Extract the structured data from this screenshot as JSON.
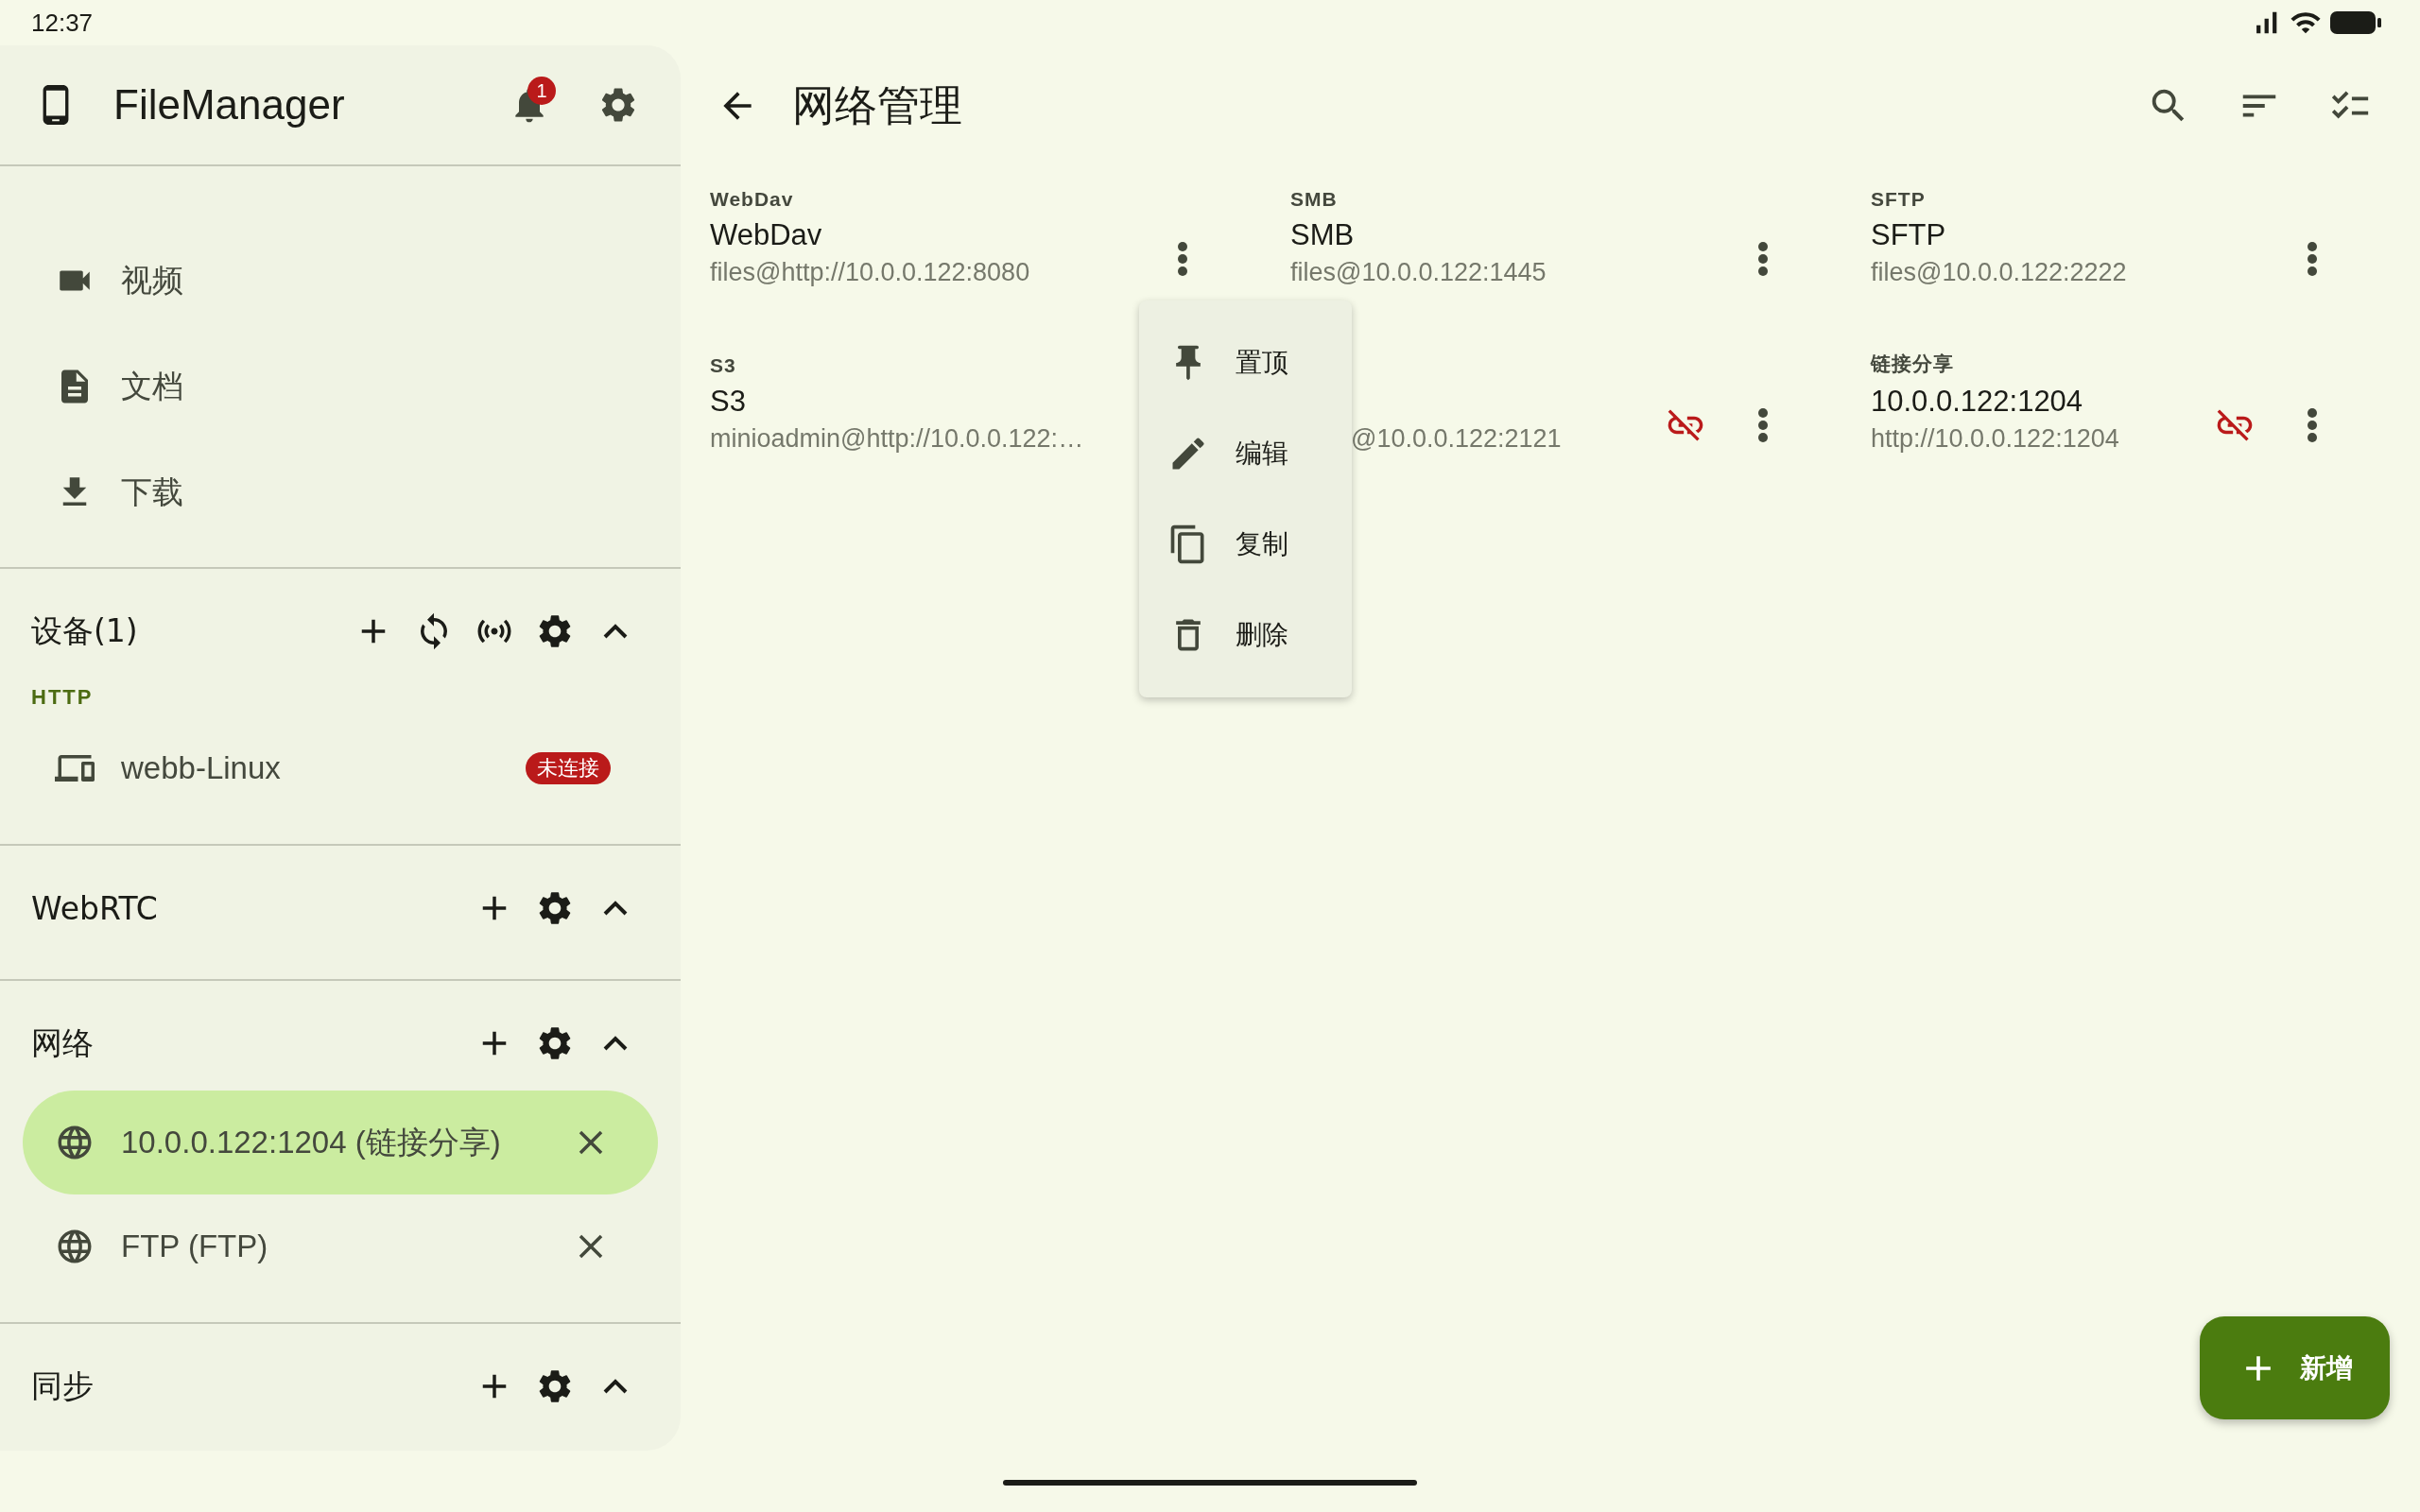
{
  "status_bar": {
    "time": "12:37"
  },
  "sidebar": {
    "title": "FileManager",
    "notification_count": "1",
    "nav_items": [
      {
        "kind": "video",
        "label": "视频"
      },
      {
        "kind": "document",
        "label": "文档"
      },
      {
        "kind": "download",
        "label": "下载"
      }
    ],
    "sections": [
      {
        "title": "设备(1)",
        "actions": [
          {
            "kind": "add"
          },
          {
            "kind": "sync"
          },
          {
            "kind": "broadcast"
          },
          {
            "kind": "settings"
          }
        ],
        "expanded": true,
        "groups": [
          {
            "subheader": "HTTP",
            "items": [
              {
                "kind": "device",
                "label": "webb-Linux",
                "badge": "未连接"
              }
            ]
          }
        ]
      },
      {
        "title": "WebRTC",
        "actions": [
          {
            "kind": "add"
          },
          {
            "kind": "settings"
          }
        ],
        "expanded": true
      },
      {
        "title": "网络",
        "actions": [
          {
            "kind": "add"
          },
          {
            "kind": "settings"
          }
        ],
        "expanded": true,
        "groups": [
          {
            "items": [
              {
                "kind": "network",
                "label": "10.0.0.122:1204 (链接分享)",
                "selected": true
              },
              {
                "kind": "network",
                "label": "FTP (FTP)",
                "selected": false
              }
            ]
          }
        ]
      },
      {
        "title": "同步",
        "actions": [
          {
            "kind": "add"
          },
          {
            "kind": "settings"
          }
        ],
        "expanded": true
      }
    ]
  },
  "main": {
    "title": "网络管理",
    "actions": [
      {
        "kind": "search"
      },
      {
        "kind": "sort"
      },
      {
        "kind": "checklist"
      }
    ],
    "connections": [
      {
        "type": "WebDav",
        "name": "WebDav",
        "address": "files@http://10.0.0.122:8080",
        "disconnected": false
      },
      {
        "type": "SMB",
        "name": "SMB",
        "address": "files@10.0.0.122:1445",
        "disconnected": false
      },
      {
        "type": "SFTP",
        "name": "SFTP",
        "address": "files@10.0.0.122:2222",
        "disconnected": false
      },
      {
        "type": "S3",
        "name": "S3",
        "address": "minioadmin@http://10.0.0.122:…",
        "disconnected": false,
        "menu_covered": true
      },
      {
        "address": "@10.0.0.122:2121",
        "disconnected": true
      },
      {
        "type": "链接分享",
        "name": "10.0.0.122:1204",
        "address": "http://10.0.0.122:1204",
        "disconnected": true
      }
    ],
    "menu": [
      {
        "kind": "pin",
        "label": "置顶"
      },
      {
        "kind": "edit",
        "label": "编辑"
      },
      {
        "kind": "copy",
        "label": "复制"
      },
      {
        "kind": "delete",
        "label": "删除"
      }
    ],
    "fab": {
      "label": "新增"
    }
  }
}
